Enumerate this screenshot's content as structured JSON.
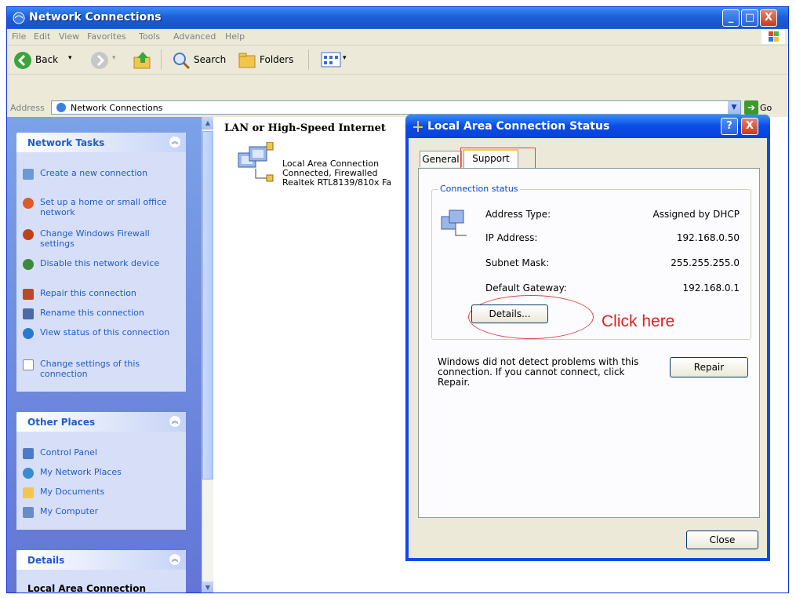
{
  "window": {
    "title": "Network Connections",
    "controls": {
      "minimize": "_",
      "maximize": "□",
      "close": "X"
    }
  },
  "menu": [
    "File",
    "Edit",
    "View",
    "Favorites",
    "Tools",
    "Advanced",
    "Help"
  ],
  "toolbar": {
    "back": "Back",
    "search": "Search",
    "folders": "Folders"
  },
  "address": {
    "label": "Address",
    "value": "Network Connections",
    "go": "Go"
  },
  "network_tasks": {
    "title": "Network Tasks",
    "items": [
      {
        "label": "Create a new connection",
        "icon": "new-connection-icon"
      },
      {
        "label": "Set up a home or small office network",
        "icon": "home-network-icon"
      },
      {
        "label": "Change Windows Firewall settings",
        "icon": "firewall-icon"
      },
      {
        "label": "Disable this network device",
        "icon": "disable-device-icon"
      },
      {
        "label": "Repair this connection",
        "icon": "repair-icon"
      },
      {
        "label": "Rename this connection",
        "icon": "rename-icon"
      },
      {
        "label": "View status of this connection",
        "icon": "status-icon"
      },
      {
        "label": "Change settings of this connection",
        "icon": "settings-icon"
      }
    ]
  },
  "other_places": {
    "title": "Other Places",
    "items": [
      {
        "label": "Control Panel",
        "icon": "control-panel-icon"
      },
      {
        "label": "My Network Places",
        "icon": "network-places-icon"
      },
      {
        "label": "My Documents",
        "icon": "documents-icon"
      },
      {
        "label": "My Computer",
        "icon": "computer-icon"
      }
    ]
  },
  "details_panel": {
    "title": "Details",
    "name": "Local Area Connection"
  },
  "content": {
    "group_title": "LAN or High-Speed Internet",
    "connection": {
      "name": "Local Area Connection",
      "status": "Connected, Firewalled",
      "device": "Realtek RTL8139/810x Fa"
    }
  },
  "dialog": {
    "title": "Local Area Connection Status",
    "help": "?",
    "close": "X",
    "tabs": [
      "General",
      "Support"
    ],
    "active_tab": "Support",
    "group_label": "Connection status",
    "rows": [
      {
        "label": "Address Type:",
        "value": "Assigned by DHCP"
      },
      {
        "label": "IP Address:",
        "value": "192.168.0.50"
      },
      {
        "label": "Subnet Mask:",
        "value": "255.255.255.0"
      },
      {
        "label": "Default Gateway:",
        "value": "192.168.0.1"
      }
    ],
    "details_button": "Details...",
    "annotation": "Click here",
    "diagnostic_text": "Windows did not detect problems with this connection. If you cannot connect, click Repair.",
    "repair_button": "Repair",
    "close_button": "Close"
  },
  "colors": {
    "titlebar": "#1d5fd8",
    "task_link": "#215dc6",
    "annotation": "#e02020"
  }
}
